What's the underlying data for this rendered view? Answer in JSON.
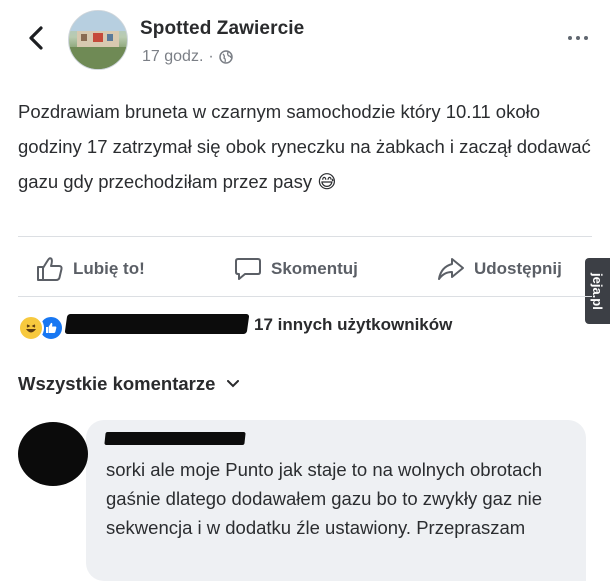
{
  "header": {
    "page_name": "Spotted Zawiercie",
    "time_ago": "17 godz.",
    "separator": "·"
  },
  "post": {
    "text": "Pozdrawiam bruneta w czarnym samochodzie który 10.11 około godziny 17 zatrzymał się obok ryneczku na żabkach i zaczął dodawać gazu gdy przechodziłam przez pasy 😅"
  },
  "actions": {
    "like_label": "Lubię to!",
    "comment_label": "Skomentuj",
    "share_label": "Udostępnij"
  },
  "watermark": {
    "text": "jeja.pl"
  },
  "reactions": {
    "others_text": "17 innych użytkowników",
    "icons": [
      "haha-reaction-icon",
      "like-reaction-icon"
    ]
  },
  "comments": {
    "filter_label": "Wszystkie komentarze",
    "items": [
      {
        "text": "sorki ale moje Punto jak staje to na wolnych obrotach gaśnie dlatego dodawałem gazu bo to zwykły gaz nie sekwencja i w dodatku źle ustawiony. Przepraszam"
      }
    ]
  },
  "colors": {
    "text": "#2b2d30",
    "muted": "#7b7f86",
    "action": "#5b5f66",
    "like_blue": "#1877f2",
    "haha_yellow": "#f7c93e",
    "bubble": "#eef0f3"
  }
}
